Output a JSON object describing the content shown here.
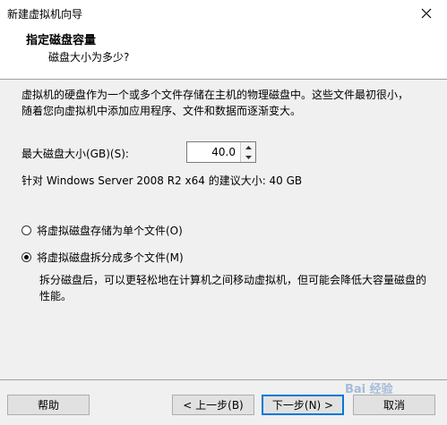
{
  "window": {
    "title": "新建虚拟机向导",
    "close_label": "✕"
  },
  "header": {
    "title": "指定磁盘容量",
    "subtitle": "磁盘大小为多少?"
  },
  "main": {
    "description": "虚拟机的硬盘作为一个或多个文件存储在主机的物理磁盘中。这些文件最初很小，随着您向虚拟机中添加应用程序、文件和数据而逐渐变大。",
    "max_size_label": "最大磁盘大小(GB)(S):",
    "max_size_value": "40.0",
    "recommended": "针对 Windows Server 2008 R2 x64 的建议大小: 40 GB",
    "options": [
      {
        "label": "将虚拟磁盘存储为单个文件(O)",
        "checked": false
      },
      {
        "label": "将虚拟磁盘拆分成多个文件(M)",
        "checked": true
      }
    ],
    "split_description": "拆分磁盘后，可以更轻松地在计算机之间移动虚拟机，但可能会降低大容量磁盘的性能。"
  },
  "footer": {
    "help": "帮助",
    "back": "< 上一步(B)",
    "next": "下一步(N) >",
    "cancel": "取消"
  },
  "watermark": "Bai 经验"
}
